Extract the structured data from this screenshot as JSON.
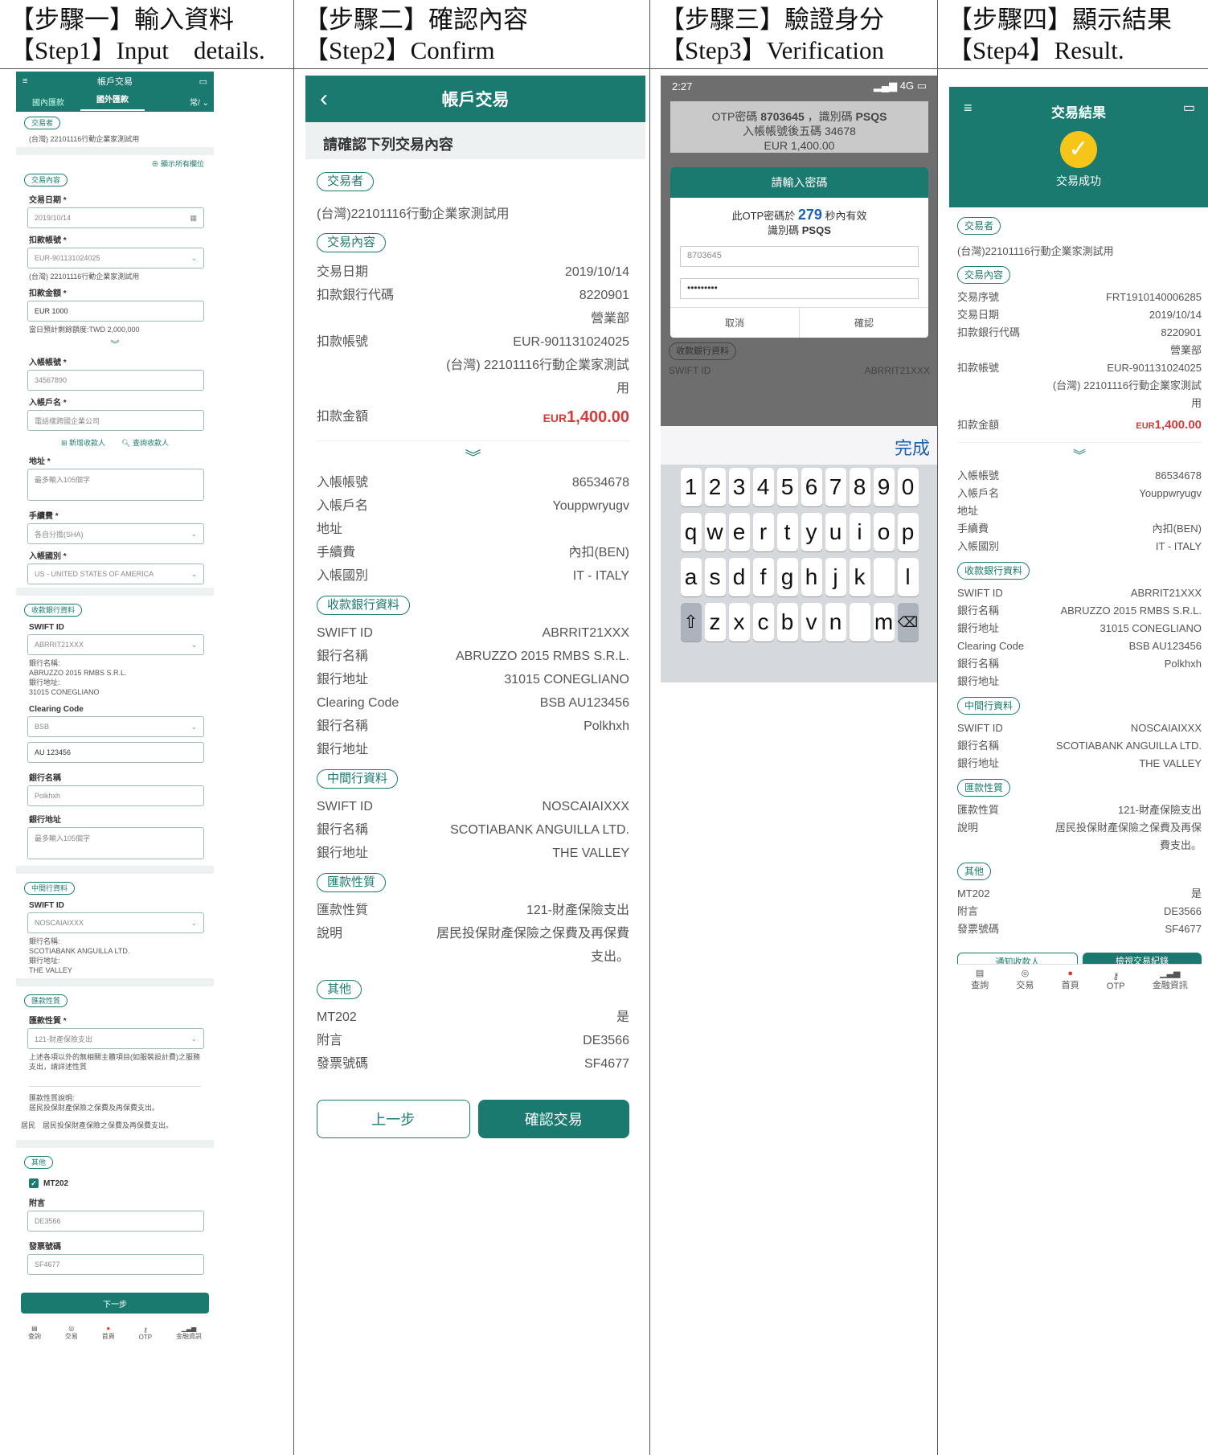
{
  "steps": [
    {
      "l1": "【步驟一】輸入資料",
      "l2": "【Step1】Input　details."
    },
    {
      "l1": "【步驟二】確認內容",
      "l2": "【Step2】Confirm"
    },
    {
      "l1": "【步驟三】驗證身分",
      "l2": "【Step3】Verification"
    },
    {
      "l1": "【步驟四】顯示結果",
      "l2": "【Step4】Result."
    }
  ],
  "s1": {
    "title": "帳戶交易",
    "tab_domestic": "國內匯款",
    "tab_foreign": "國外匯款",
    "tab_common": "常/",
    "trader_pill": "交易者",
    "trader": "(台灣) 22101116行動企業家測試用",
    "show_all": "顯示所有欄位",
    "content_pill": "交易內容",
    "date_label": "交易日期 *",
    "date": "2019/10/14",
    "acct_label": "扣款帳號 *",
    "acct": "EUR-901131024025",
    "acct_name": "(台灣) 22101116行動企業家測試用",
    "amt_label": "扣款金額 *",
    "amt": "EUR 1000",
    "limit": "當日預計剩餘額度:TWD 2,000,000",
    "in_acct_label": "入帳帳號 *",
    "in_acct": "34567890",
    "in_name_label": "入帳戶名 *",
    "in_name": "電話樣跨國企業公司",
    "add_payee": "新增收款人",
    "query_payee": "查詢收款人",
    "addr_label": "地址 *",
    "addr_ph": "最多輸入105個字",
    "fee_label": "手續費 *",
    "fee": "各自分擔(SHA)",
    "country_label": "入帳國別 *",
    "country": "US - UNITED STATES OF AMERICA",
    "bank_pill": "收款銀行資料",
    "swift_label": "SWIFT ID",
    "swift": "ABRRIT21XXX",
    "bank_info": [
      "銀行名稱:",
      "ABRUZZO 2015 RMBS S.R.L.",
      "銀行地址:",
      "31015 CONEGLIANO"
    ],
    "clearing_label": "Clearing Code",
    "clearing_type": "BSB",
    "clearing_code": "AU 123456",
    "bname_label": "銀行名稱",
    "bname": "Polkhxh",
    "baddr_label": "銀行地址",
    "baddr_ph": "最多輸入105個字",
    "mid_pill": "中間行資料",
    "mid_swift_label": "SWIFT ID",
    "mid_swift": "NOSCAIAIXXX",
    "mid_info": [
      "銀行名稱:",
      "SCOTIABANK ANGUILLA LTD.",
      "銀行地址:",
      "THE VALLEY"
    ],
    "nature_pill": "匯款性質",
    "nature_label": "匯款性質 *",
    "nature": "121-財產保險支出",
    "nature_note": "上述各項以外的無相關主體項目(如服裝設計費)之服務支出，請詳述性質",
    "nature_desc_label": "匯款性質說明:",
    "nature_desc": "居民投保財產保險之保費及再保費支出。",
    "nature_desc2_label": "居民",
    "nature_desc2": "居民投保財產保險之保費及再保費支出。",
    "other_pill": "其他",
    "mt202": "MT202",
    "memo_label": "附言",
    "memo": "DE3566",
    "inv_label": "發票號碼",
    "inv": "SF4677",
    "next": "下一步"
  },
  "nav": [
    "查詢",
    "交易",
    "首頁",
    "OTP",
    "金融資訊"
  ],
  "s2": {
    "title": "帳戶交易",
    "subtitle": "請確認下列交易內容",
    "trader_pill": "交易者",
    "trader": "(台灣)22101116行動企業家測試用",
    "content_pill": "交易內容",
    "rows1": [
      [
        "交易日期",
        "2019/10/14"
      ],
      [
        "扣款銀行代碼",
        "8220901"
      ],
      [
        "",
        "營業部"
      ],
      [
        "扣款帳號",
        "EUR-901131024025"
      ],
      [
        "",
        "(台灣) 22101116行動企業家測試用"
      ]
    ],
    "amt_label": "扣款金額",
    "amt_cur": "EUR",
    "amt": "1,400.00",
    "rows2": [
      [
        "入帳帳號",
        "86534678"
      ],
      [
        "入帳戶名",
        "Youppwryugv"
      ],
      [
        "地址",
        ""
      ],
      [
        "手續費",
        "內扣(BEN)"
      ],
      [
        "入帳國別",
        "IT - ITALY"
      ]
    ],
    "bank_pill": "收款銀行資料",
    "rows3": [
      [
        "SWIFT ID",
        "ABRRIT21XXX"
      ],
      [
        "銀行名稱",
        "ABRUZZO 2015 RMBS S.R.L."
      ],
      [
        "銀行地址",
        "31015 CONEGLIANO"
      ],
      [
        "Clearing Code",
        "BSB AU123456"
      ],
      [
        "銀行名稱",
        "Polkhxh"
      ],
      [
        "銀行地址",
        ""
      ]
    ],
    "mid_pill": "中間行資料",
    "rows4": [
      [
        "SWIFT ID",
        "NOSCAIAIXXX"
      ],
      [
        "銀行名稱",
        "SCOTIABANK ANGUILLA LTD."
      ],
      [
        "銀行地址",
        "THE VALLEY"
      ]
    ],
    "nature_pill": "匯款性質",
    "rows5": [
      [
        "匯款性質",
        "121-財產保險支出"
      ],
      [
        "說明",
        "居民投保財產保險之保費及再保費支出。"
      ]
    ],
    "other_pill": "其他",
    "rows6": [
      [
        "MT202",
        "是"
      ],
      [
        "附言",
        "DE3566"
      ],
      [
        "發票號碼",
        "SF4677"
      ]
    ],
    "back": "上一步",
    "confirm": "確認交易"
  },
  "s3": {
    "time": "2:27",
    "signal": "4G",
    "bg_line1a": "OTP密碼",
    "bg_otp": "8703645",
    "bg_line1b": "，識別碼",
    "bg_id": "PSQS",
    "bg_line2": "入帳帳號後五碼 34678",
    "bg_line3": "EUR 1,400.00",
    "dlg_title": "請輸入密碼",
    "dlg_l1a": "此OTP密碼於",
    "dlg_secs": "279",
    "dlg_l1b": "秒內有效",
    "dlg_l2a": "識別碼",
    "dlg_l2b": "PSQS",
    "otp_value": "8703645",
    "pwd": "•••••••••",
    "cancel": "取消",
    "ok": "確認",
    "bg_pill": "收款銀行資料",
    "bg_swift_l": "SWIFT ID",
    "bg_swift": "ABRRIT21XXX",
    "done": "完成",
    "keys1": [
      "1",
      "2",
      "3",
      "4",
      "5",
      "6",
      "7",
      "8",
      "9",
      "0"
    ],
    "keys2": [
      "q",
      "w",
      "e",
      "r",
      "t",
      "y",
      "u",
      "i",
      "o",
      "p"
    ],
    "keys3": [
      "a",
      "s",
      "d",
      "f",
      "g",
      "h",
      "j",
      "k",
      "",
      "l"
    ],
    "keys4": [
      "z",
      "x",
      "c",
      "b",
      "v",
      "n",
      "",
      "m"
    ]
  },
  "s4": {
    "title": "交易結果",
    "success": "交易成功",
    "trader_pill": "交易者",
    "trader": "(台灣)22101116行動企業家測試用",
    "content_pill": "交易內容",
    "rows1": [
      [
        "交易序號",
        "FRT1910140006285"
      ],
      [
        "交易日期",
        "2019/10/14"
      ],
      [
        "扣款銀行代碼",
        "8220901"
      ],
      [
        "",
        "營業部"
      ],
      [
        "扣款帳號",
        "EUR-901131024025"
      ],
      [
        "",
        "(台灣) 22101116行動企業家測試用"
      ]
    ],
    "amt_label": "扣款金額",
    "amt_cur": "EUR",
    "amt": "1,400.00",
    "rows2": [
      [
        "入帳帳號",
        "86534678"
      ],
      [
        "入帳戶名",
        "Youppwryugv"
      ],
      [
        "地址",
        ""
      ],
      [
        "手續費",
        "內扣(BEN)"
      ],
      [
        "入帳國別",
        "IT - ITALY"
      ]
    ],
    "bank_pill": "收款銀行資料",
    "rows3": [
      [
        "SWIFT ID",
        "ABRRIT21XXX"
      ],
      [
        "銀行名稱",
        "ABRUZZO 2015 RMBS S.R.L."
      ],
      [
        "銀行地址",
        "31015 CONEGLIANO"
      ],
      [
        "Clearing Code",
        "BSB AU123456"
      ],
      [
        "銀行名稱",
        "Polkhxh"
      ],
      [
        "銀行地址",
        ""
      ]
    ],
    "mid_pill": "中間行資料",
    "rows4": [
      [
        "SWIFT ID",
        "NOSCAIAIXXX"
      ],
      [
        "銀行名稱",
        "SCOTIABANK ANGUILLA LTD."
      ],
      [
        "銀行地址",
        "THE VALLEY"
      ]
    ],
    "nature_pill": "匯款性質",
    "rows5": [
      [
        "匯款性質",
        "121-財產保險支出"
      ],
      [
        "說明",
        "居民投保財產保險之保費及再保費支出。"
      ]
    ],
    "other_pill": "其他",
    "rows6": [
      [
        "MT202",
        "是"
      ],
      [
        "附言",
        "DE3566"
      ],
      [
        "發票號碼",
        "SF4677"
      ]
    ],
    "btn_left": "通知收款人",
    "btn_right": "檢視交易紀錄"
  },
  "colors": {
    "brand": "#1a7a6f",
    "amount": "#d63b3b",
    "success": "#f5c518"
  }
}
